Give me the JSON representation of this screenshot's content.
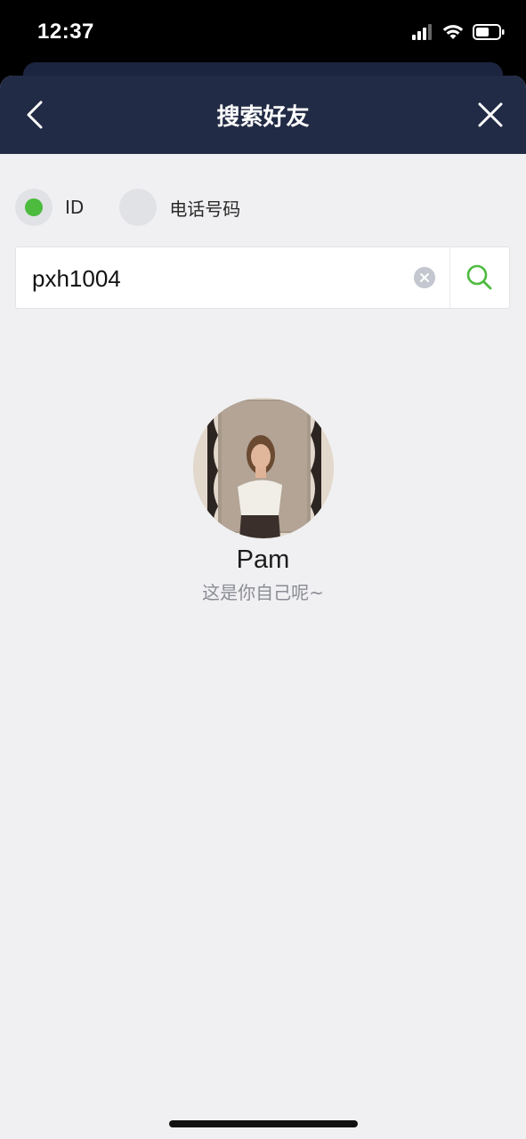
{
  "status_bar": {
    "time": "12:37",
    "icons": [
      "cellular-signal-icon",
      "wifi-icon",
      "battery-icon"
    ]
  },
  "header": {
    "title": "搜索好友",
    "back_icon": "chevron-left-icon",
    "close_icon": "close-icon"
  },
  "search_type": {
    "options": [
      {
        "label": "ID",
        "selected": true
      },
      {
        "label": "电话号码",
        "selected": false
      }
    ]
  },
  "search": {
    "value": "pxh1004",
    "clear_icon": "clear-circle-icon",
    "search_icon": "search-icon"
  },
  "result": {
    "name": "Pam",
    "note": "这是你自己呢~"
  },
  "colors": {
    "header_bg": "#222b45",
    "page_bg": "#f0f0f2",
    "accent_green": "#4cbb3e"
  }
}
